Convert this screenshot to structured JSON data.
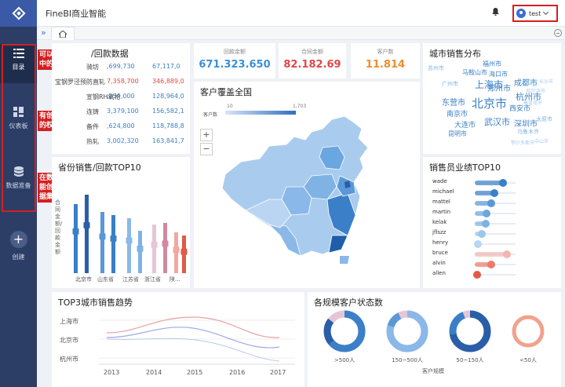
{
  "app": {
    "title": "FineBI商业智能",
    "user": "test"
  },
  "sidebar": {
    "items": [
      {
        "label": "目录",
        "icon": "list-icon"
      },
      {
        "label": "仪表板",
        "icon": "dashboard-icon"
      },
      {
        "label": "数据准备",
        "icon": "database-icon"
      },
      {
        "label": "创建",
        "icon": "plus-icon"
      }
    ],
    "annotations": [
      "可以查看目录中的仪表板",
      "有创建仪表板的权限",
      "在数据准备下能创建自助数据集"
    ]
  },
  "tabs": {
    "home_icon": "home-icon"
  },
  "kpis": [
    {
      "label": "回款金额",
      "value": "671.323.650",
      "color": "#3a8fd8"
    },
    {
      "label": "合同金额",
      "value": "82.182.69",
      "color": "#e04848"
    },
    {
      "label": "客户数",
      "value": "11.814",
      "color": "#f08c2e"
    }
  ],
  "contract_table": {
    "title": "/回款数据",
    "rows": [
      {
        "name": "骑坊",
        "a": ",699,730",
        "b": "67,117,0"
      },
      {
        "name": "宝钢罗泾预防直轧",
        "a": "7,358,700",
        "b": "346,889,0"
      },
      {
        "name": "宣钢RH氧枪",
        "a": ",259,000",
        "b": "128,964,0"
      },
      {
        "name": "连铸",
        "a": "3,379,100",
        "b": "156,582,1"
      },
      {
        "name": "备件",
        "a": ",624,800",
        "b": "118,788,8"
      },
      {
        "name": "热轧",
        "a": "3,002,320",
        "b": "163,841,7"
      }
    ]
  },
  "province_chart": {
    "title": "省份销售/回款TOP10",
    "ylabel": "合同金额/回款金额",
    "categories": [
      "北京市",
      "山东省",
      "江苏省",
      "浙江省",
      "陕..."
    ]
  },
  "map_card": {
    "title": "客户覆盖全国",
    "legend_label": "客户数",
    "legend_min": "10",
    "legend_max": "1,703"
  },
  "city_card": {
    "title": "城市销售分布",
    "words": [
      {
        "t": "北京市",
        "s": 15,
        "c": "#3a7fc8"
      },
      {
        "t": "上海市",
        "s": 12,
        "c": "#3a7fc8"
      },
      {
        "t": "杭州市",
        "s": 11,
        "c": "#3a7fc8"
      },
      {
        "t": "武汉市",
        "s": 11,
        "c": "#3a7fc8"
      },
      {
        "t": "深圳市",
        "s": 10,
        "c": "#3a7fc8"
      },
      {
        "t": "郑州市",
        "s": 10,
        "c": "#3a7fc8"
      },
      {
        "t": "成都市",
        "s": 10,
        "c": "#3a7fc8"
      },
      {
        "t": "东营市",
        "s": 10,
        "c": "#3a7fc8"
      },
      {
        "t": "南京市",
        "s": 9,
        "c": "#3a7fc8"
      },
      {
        "t": "西安市",
        "s": 9,
        "c": "#3a7fc8"
      },
      {
        "t": "大连市",
        "s": 9,
        "c": "#3a7fc8"
      },
      {
        "t": "昆明市",
        "s": 8,
        "c": "#3a7fc8"
      },
      {
        "t": "马鞍山市",
        "s": 8,
        "c": "#3a7fc8"
      },
      {
        "t": "海口市",
        "s": 8,
        "c": "#3a7fc8"
      },
      {
        "t": "福州市",
        "s": 8,
        "c": "#3a7fc8"
      },
      {
        "t": "广州市",
        "s": 7,
        "c": "#7fb3e3"
      },
      {
        "t": "乌鲁木齐",
        "s": 7,
        "c": "#7fb3e3"
      },
      {
        "t": "苏州市",
        "s": 7,
        "c": "#7fb3e3"
      },
      {
        "t": "长沙市",
        "s": 6,
        "c": "#a9cbee"
      },
      {
        "t": "哈尔滨市",
        "s": 6,
        "c": "#a9cbee"
      },
      {
        "t": "秦皇岛市",
        "s": 6,
        "c": "#a9cbee"
      },
      {
        "t": "鄂尔多斯市",
        "s": 6,
        "c": "#a9cbee"
      },
      {
        "t": "中山市",
        "s": 6,
        "c": "#a9cbee"
      },
      {
        "t": "太原市",
        "s": 7,
        "c": "#7fb3e3"
      }
    ]
  },
  "employee_card": {
    "title": "销售员业绩TOP10",
    "items": [
      {
        "name": "wade",
        "v": 0.7,
        "color": "#3a7fc8"
      },
      {
        "name": "michael",
        "v": 0.48,
        "color": "#3a7fc8"
      },
      {
        "name": "mattel",
        "v": 0.4,
        "color": "#5a98d8"
      },
      {
        "name": "martin",
        "v": 0.28,
        "color": "#6aa6e0"
      },
      {
        "name": "kelak",
        "v": 0.26,
        "color": "#7ab3e6"
      },
      {
        "name": "jflszz",
        "v": 0.18,
        "color": "#9cc6ec"
      },
      {
        "name": "henry",
        "v": 0.08,
        "color": "#b8d6f2"
      },
      {
        "name": "bruce",
        "v": 0.78,
        "color": "#f0b8b0"
      },
      {
        "name": "alvin",
        "v": 0.4,
        "color": "#ec7a6a"
      },
      {
        "name": "allen",
        "v": 0.05,
        "color": "#e05a48"
      }
    ]
  },
  "trend_card": {
    "title": "TOP3城市销售趋势",
    "cities": [
      "上海市",
      "北京市",
      "杭州市"
    ],
    "years": [
      "2013",
      "2014",
      "2015",
      "2016",
      "2017"
    ]
  },
  "status_card": {
    "title": "各规模客户状态数",
    "groups": [
      ">500人",
      "150~500人",
      "50~150人",
      "<50人"
    ],
    "xlabel": "客户规模"
  }
}
